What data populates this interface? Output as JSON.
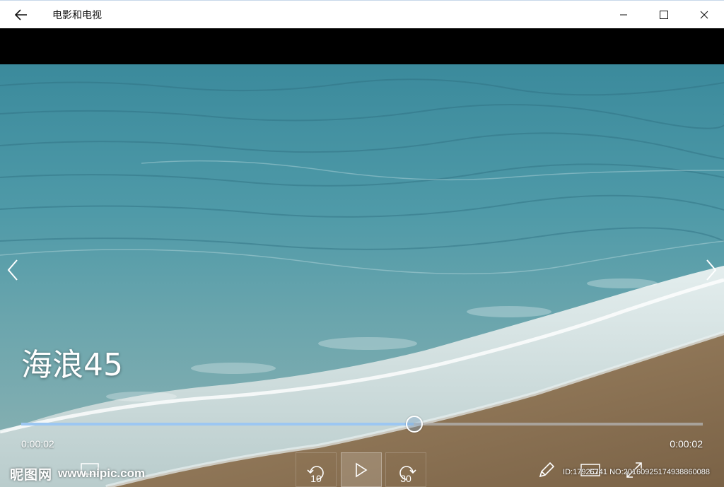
{
  "app": {
    "title": "电影和电视"
  },
  "video": {
    "title": "海浪45",
    "elapsed": "0:00:02",
    "remaining": "0:00:02",
    "progress_percent": 57.6
  },
  "controls": {
    "skip_back_label": "10",
    "skip_forward_label": "30"
  },
  "watermark": {
    "logo": "昵图网",
    "url": "www.nipic.com",
    "id_line": "ID:17926741 NO:20160925174938860088"
  },
  "colors": {
    "accent": "#9cc7f2",
    "titlebar_bg": "#ffffff"
  }
}
